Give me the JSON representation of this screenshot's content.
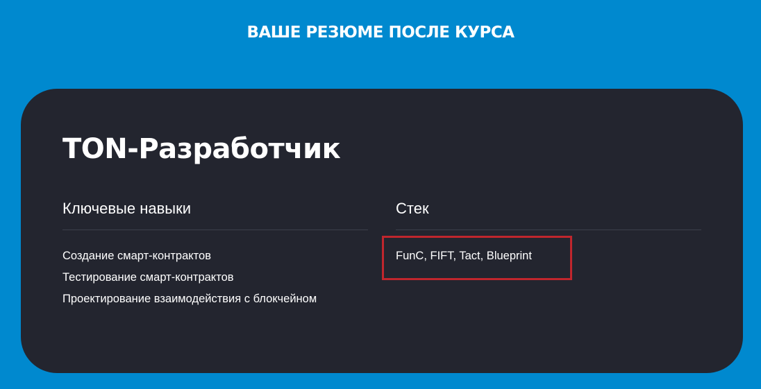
{
  "page": {
    "section_title": "ВАШЕ РЕЗЮМЕ ПОСЛЕ КУРСА"
  },
  "card": {
    "title": "TON-Разработчик",
    "skills": {
      "heading": "Ключевые навыки",
      "items": [
        "Создание смарт-контрактов",
        "Тестирование смарт-контрактов",
        "Проектирование взаимодействия с блокчейном"
      ]
    },
    "stack": {
      "heading": "Стек",
      "items": [
        "FunC, FIFT, Tact, Blueprint"
      ]
    }
  },
  "colors": {
    "background": "#0089cf",
    "card": "#23252f",
    "text": "#ffffff",
    "highlight": "#c0262d"
  }
}
